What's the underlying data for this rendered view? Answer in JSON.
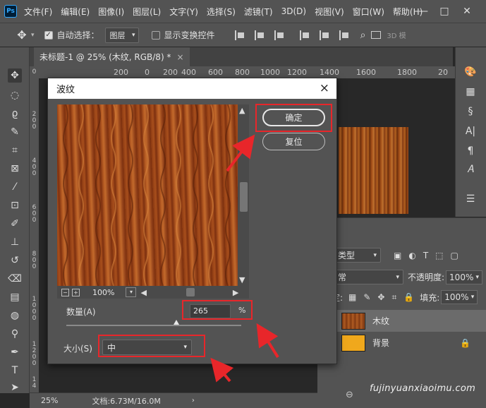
{
  "app": {
    "logo": "Ps"
  },
  "menu": [
    "文件(F)",
    "编辑(E)",
    "图像(I)",
    "图层(L)",
    "文字(Y)",
    "选择(S)",
    "滤镜(T)",
    "3D(D)",
    "视图(V)",
    "窗口(W)",
    "帮助(H)"
  ],
  "options_bar": {
    "auto_select_label": "自动选择：",
    "auto_select_checked": true,
    "target": "图层",
    "show_transform_label": "显示变换控件",
    "show_transform_checked": false,
    "mode_3d": "3D 模"
  },
  "document_tab": {
    "title": "未标题-1 @ 25% (木纹, RGB/8) *",
    "close": "×"
  },
  "ruler_h": [
    "200",
    "0",
    "200",
    "400",
    "600",
    "800",
    "1000",
    "1200",
    "1400",
    "1600",
    "1800",
    "20"
  ],
  "ruler_v": [
    "0",
    "2",
    "0",
    "0",
    "4",
    "0",
    "0",
    "6",
    "0",
    "0",
    "8",
    "0",
    "0",
    "1",
    "0",
    "0",
    "0",
    "1",
    "2",
    "0",
    "0",
    "1",
    "4"
  ],
  "dialog": {
    "title": "波纹",
    "close": "×",
    "ok_label": "确定",
    "reset_label": "复位",
    "zoom": "100%",
    "amount_label": "数量(A)",
    "amount_value": "265",
    "amount_unit": "%",
    "amount_slider_fraction": 0.63,
    "size_label": "大小(S)",
    "size_value": "中"
  },
  "layers": {
    "kind_filter": "类型",
    "blend_mode": "常",
    "opacity_label": "不透明度:",
    "opacity_value": "100%",
    "lock_label": "锁定:",
    "fill_label": "填充:",
    "fill_value": "100%",
    "items": [
      {
        "name": "木纹",
        "selected": true,
        "thumb": "#9a4a1a"
      },
      {
        "name": "背景",
        "selected": false,
        "thumb": "#f0a81c"
      }
    ]
  },
  "status": {
    "zoom": "25%",
    "doc": "文档:6.73M/16.0M"
  },
  "watermark": "fujinyuanxiaoimu.com",
  "colors": {
    "highlight": "#e8262a",
    "panel": "#535353",
    "canvas": "#282828"
  }
}
